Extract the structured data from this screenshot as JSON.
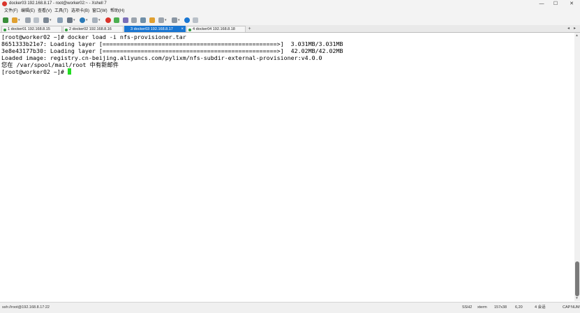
{
  "window": {
    "title": "docker03 192.168.8.17 - root@worker02:~ - Xshell 7",
    "controls": {
      "minimize": "—",
      "maximize": "☐",
      "close": "✕"
    }
  },
  "menu": [
    "文件(F)",
    "编辑(E)",
    "查看(V)",
    "工具(T)",
    "选项卡(B)",
    "窗口(W)",
    "帮助(H)"
  ],
  "tabs": [
    {
      "label": "1 docker01 192.168.8.15",
      "active": false
    },
    {
      "label": "2 docker02 192.168.8.16",
      "active": false
    },
    {
      "label": "3 docker03 192.168.8.17",
      "active": true
    },
    {
      "label": "4 docker04 192.168.8.18",
      "active": false
    }
  ],
  "tab_close": "×",
  "tab_add": "+",
  "tab_nav": {
    "prev": "◂",
    "next": "▸"
  },
  "terminal": {
    "lines": [
      "[root@worker02 ~]# docker load -i nfs-provisioner.tar",
      "8651333b21e7: Loading layer [==================================================>]  3.031MB/3.031MB",
      "3e8e43177b30: Loading layer [==================================================>]  42.02MB/42.02MB",
      "Loaded image: registry.cn-beijing.aliyuncs.com/pylixm/nfs-subdir-external-provisioner:v4.0.0",
      "您在 /var/spool/mail/root 中有新邮件",
      "[root@worker02 ~]# "
    ],
    "cursor_color": "#22dd22"
  },
  "status": {
    "connection": "ssh://root@192.168.8.17:22",
    "protocol": "SSH2",
    "terminal_type": "xterm",
    "size": "157x38",
    "cursor_pos": "6,20",
    "sessions": "4 会话",
    "caps": "CAP",
    "num": "NUM"
  },
  "colors": {
    "accent": "#1976d2",
    "cursor": "#22dd22",
    "online_dot": "#2e9a3a"
  }
}
